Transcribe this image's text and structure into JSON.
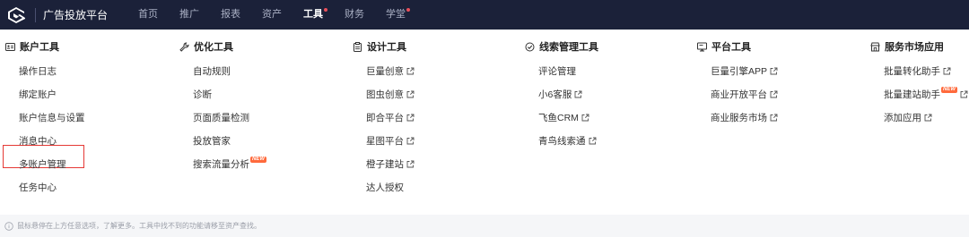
{
  "header": {
    "brand": "广告投放平台",
    "nav": [
      {
        "label": "首页",
        "active": false,
        "dot": false
      },
      {
        "label": "推广",
        "active": false,
        "dot": false
      },
      {
        "label": "报表",
        "active": false,
        "dot": false
      },
      {
        "label": "资产",
        "active": false,
        "dot": false
      },
      {
        "label": "工具",
        "active": true,
        "dot": true
      },
      {
        "label": "财务",
        "active": false,
        "dot": false
      },
      {
        "label": "学堂",
        "active": false,
        "dot": true
      }
    ]
  },
  "menu": {
    "columns": [
      {
        "title": "账户工具",
        "icon": "id-card-icon",
        "items": [
          {
            "label": "操作日志",
            "external": false,
            "new": false
          },
          {
            "label": "绑定账户",
            "external": false,
            "new": false
          },
          {
            "label": "账户信息与设置",
            "external": false,
            "new": false,
            "highlighted": true
          },
          {
            "label": "消息中心",
            "external": false,
            "new": false
          },
          {
            "label": "多账户管理",
            "external": false,
            "new": false
          },
          {
            "label": "任务中心",
            "external": false,
            "new": false
          }
        ]
      },
      {
        "title": "优化工具",
        "icon": "wrench-icon",
        "items": [
          {
            "label": "自动规则",
            "external": false,
            "new": false
          },
          {
            "label": "诊断",
            "external": false,
            "new": false
          },
          {
            "label": "页面质量检测",
            "external": false,
            "new": false
          },
          {
            "label": "投放管家",
            "external": false,
            "new": false
          },
          {
            "label": "搜索流量分析",
            "external": false,
            "new": true
          }
        ]
      },
      {
        "title": "设计工具",
        "icon": "clipboard-icon",
        "items": [
          {
            "label": "巨量创意",
            "external": true,
            "new": false
          },
          {
            "label": "图虫创意",
            "external": true,
            "new": false
          },
          {
            "label": "即合平台",
            "external": true,
            "new": false
          },
          {
            "label": "星图平台",
            "external": true,
            "new": false
          },
          {
            "label": "橙子建站",
            "external": true,
            "new": false
          },
          {
            "label": "达人授权",
            "external": false,
            "new": false
          }
        ]
      },
      {
        "title": "线索管理工具",
        "icon": "shield-check-icon",
        "items": [
          {
            "label": "评论管理",
            "external": false,
            "new": false
          },
          {
            "label": "小6客服",
            "external": true,
            "new": false
          },
          {
            "label": "飞鱼CRM",
            "external": true,
            "new": false
          },
          {
            "label": "青鸟线索通",
            "external": true,
            "new": false
          }
        ]
      },
      {
        "title": "平台工具",
        "icon": "monitor-icon",
        "items": [
          {
            "label": "巨量引擎APP",
            "external": true,
            "new": false
          },
          {
            "label": "商业开放平台",
            "external": true,
            "new": false
          },
          {
            "label": "商业服务市场",
            "external": true,
            "new": false
          }
        ]
      },
      {
        "title": "服务市场应用",
        "icon": "store-icon",
        "items": [
          {
            "label": "批量转化助手",
            "external": true,
            "new": false
          },
          {
            "label": "批量建站助手",
            "external": true,
            "new": true
          },
          {
            "label": "添加应用",
            "external": true,
            "new": false
          }
        ]
      }
    ],
    "new_badge": "NEW"
  },
  "footer": {
    "tip": "鼠标悬停在上方任意选项，了解更多。工具中找不到的功能请移至资产查找。"
  },
  "colors": {
    "topbar": "#1b2139",
    "highlight": "#e53935",
    "badge": "#ff6a3c"
  }
}
